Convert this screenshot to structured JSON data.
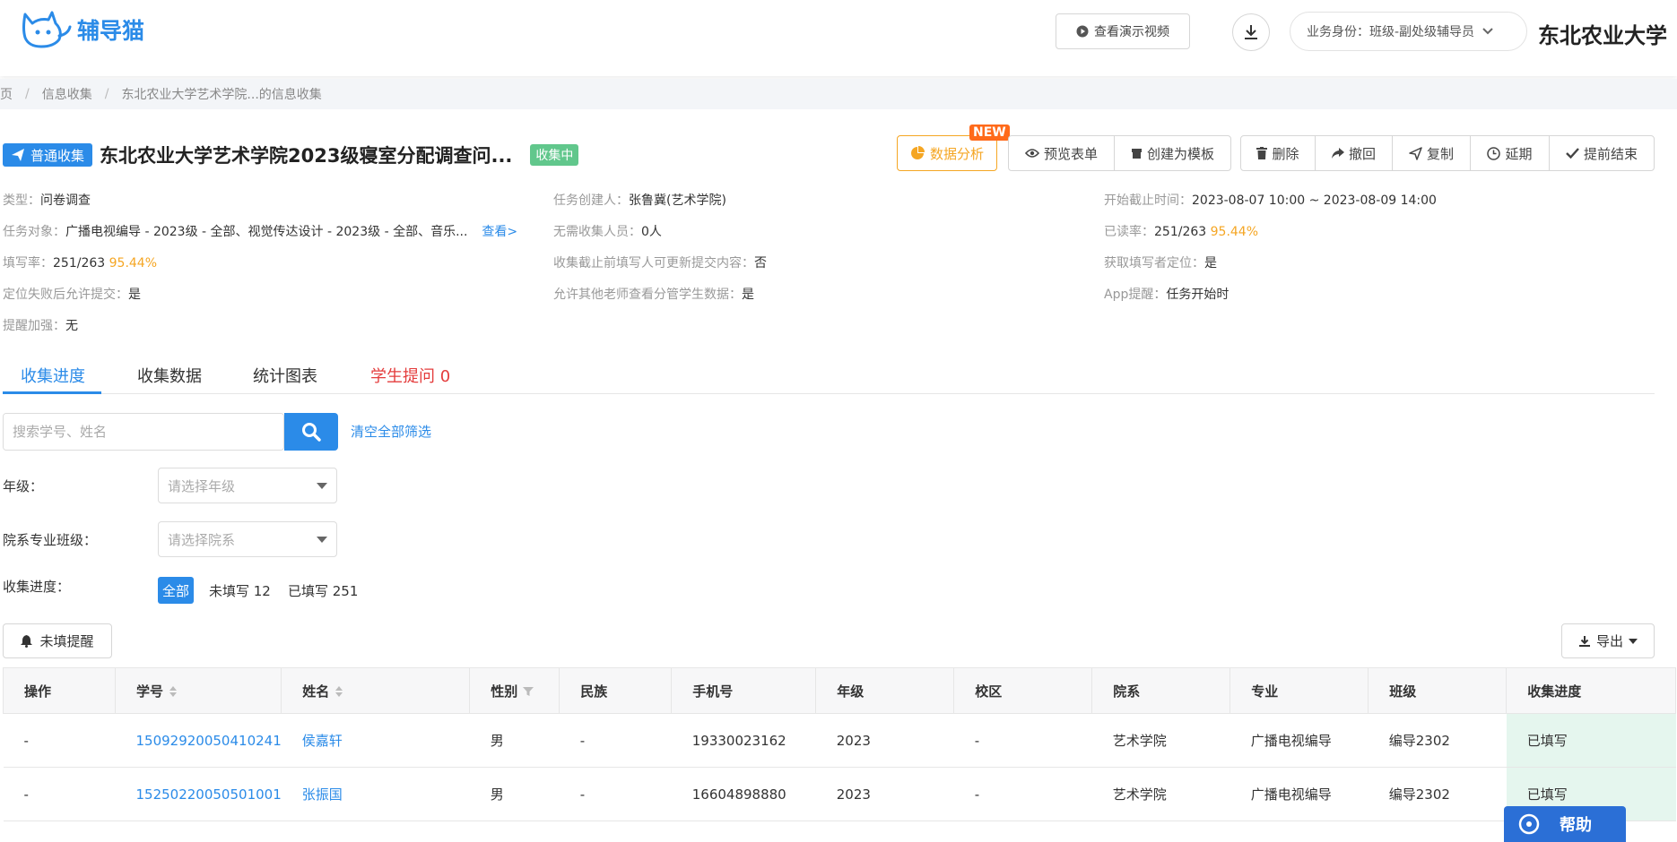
{
  "app": {
    "name": "辅导猫",
    "university": "东北农业大学"
  },
  "header": {
    "demo_video": "查看演示视频",
    "role": "业务身份：班级-副处级辅导员"
  },
  "breadcrumb": [
    "页",
    "信息收集",
    "东北农业大学艺术学院...的信息收集"
  ],
  "task": {
    "type_tag": "普通收集",
    "title": "东北农业大学艺术学院2023级寝室分配调查问...",
    "status": "收集中"
  },
  "actions": {
    "analysis": "数据分析",
    "new_badge": "NEW",
    "preview": "预览表单",
    "create_template": "创建为模板",
    "delete": "删除",
    "withdraw": "撤回",
    "copy": "复制",
    "extend": "延期",
    "finish_early": "提前结束"
  },
  "info": {
    "type_k": "类型：",
    "type_v": "问卷调查",
    "creator_k": "任务创建人：",
    "creator_v": "张鲁冀(艺术学院)",
    "time_k": "开始截止时间：",
    "time_v": "2023-08-07 10:00 ~ 2023-08-09 14:00",
    "target_k": "任务对象：",
    "target_v": "广播电视编导 - 2023级 - 全部、视觉传达设计 - 2023级 - 全部、音乐...",
    "target_link": "查看>",
    "nocollect_k": "无需收集人员：",
    "nocollect_v": "0人",
    "read_k": "已读率：",
    "read_v": "251/263",
    "read_pct": "95.44%",
    "fill_k": "填写率：",
    "fill_v": "251/263",
    "fill_pct": "95.44%",
    "update_k": "收集截止前填写人可更新提交内容：",
    "update_v": "否",
    "locate_k": "获取填写者定位：",
    "locate_v": "是",
    "locfail_k": "定位失败后允许提交：",
    "locfail_v": "是",
    "otherview_k": "允许其他老师查看分管学生数据：",
    "otherview_v": "是",
    "apprem_k": "App提醒：",
    "apprem_v": "任务开始时",
    "strong_k": "提醒加强：",
    "strong_v": "无"
  },
  "tabs": [
    "收集进度",
    "收集数据",
    "统计图表",
    "学生提问 0"
  ],
  "filters": {
    "search_placeholder": "搜索学号、姓名",
    "clear_all": "清空全部筛选",
    "grade_label": "年级：",
    "grade_placeholder": "请选择年级",
    "dept_label": "院系专业班级：",
    "dept_placeholder": "请选择院系",
    "progress_label": "收集进度：",
    "progress_all": "全部",
    "progress_unfilled": "未填写 12",
    "progress_filled": "已填写 251"
  },
  "remind_btn": "未填提醒",
  "export_btn": "导出",
  "table": {
    "headers": [
      "操作",
      "学号",
      "姓名",
      "性别",
      "民族",
      "手机号",
      "年级",
      "校区",
      "院系",
      "专业",
      "班级",
      "收集进度"
    ],
    "rows": [
      [
        "-",
        "15092920050410241",
        "侯嘉轩",
        "男",
        "-",
        "19330023162",
        "2023",
        "-",
        "艺术学院",
        "广播电视编导",
        "编导2302",
        "已填写"
      ],
      [
        "-",
        "15250220050501001",
        "张振国",
        "男",
        "-",
        "16604898880",
        "2023",
        "-",
        "艺术学院",
        "广播电视编导",
        "编导2302",
        "已填写"
      ]
    ]
  },
  "help": "帮助"
}
